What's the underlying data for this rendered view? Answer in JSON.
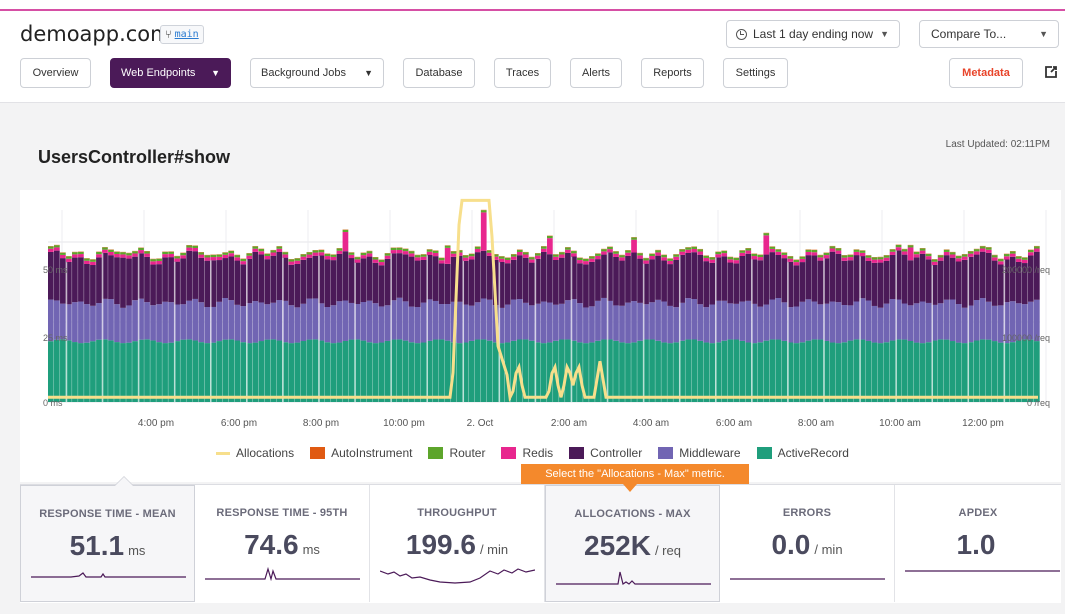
{
  "header": {
    "app_title": "demoapp.com",
    "branch": "main",
    "time_range": "Last 1 day ending now",
    "compare": "Compare To..."
  },
  "nav": {
    "overview": "Overview",
    "web_endpoints": "Web Endpoints",
    "background_jobs": "Background Jobs",
    "database": "Database",
    "traces": "Traces",
    "alerts": "Alerts",
    "reports": "Reports",
    "settings": "Settings",
    "metadata": "Metadata"
  },
  "page": {
    "title": "UsersController#show",
    "last_updated": "Last Updated: 02:11PM"
  },
  "chart_data": {
    "type": "area",
    "stacked": true,
    "x": [
      "4:00 pm",
      "6:00 pm",
      "8:00 pm",
      "10:00 pm",
      "2. Oct",
      "2:00 am",
      "4:00 am",
      "6:00 am",
      "8:00 am",
      "10:00 am",
      "12:00 pm"
    ],
    "y_left_ticks": [
      "0 ms",
      "25 ms",
      "50 ms"
    ],
    "y_right_ticks": [
      "0 /req",
      "100000 /req",
      "200000 /req"
    ],
    "ylim_left": [
      0,
      60
    ],
    "series": [
      {
        "name": "ActiveRecord",
        "color": "#1f9e7c",
        "typical": 19
      },
      {
        "name": "Middleware",
        "color": "#7165b3",
        "typical": 12
      },
      {
        "name": "Controller",
        "color": "#4b1a58",
        "typical": 14
      },
      {
        "name": "Redis",
        "color": "#e8268e",
        "typical": 1
      },
      {
        "name": "Router",
        "color": "#5da52b",
        "typical": 0.7
      },
      {
        "name": "AutoInstrument",
        "color": "#e05a12",
        "typical": 0.1
      }
    ],
    "line_series": {
      "name": "Allocations",
      "color": "#f7df8c",
      "axis": "right",
      "peak": 252000
    },
    "grid": true
  },
  "legend": [
    "Allocations",
    "AutoInstrument",
    "Router",
    "Redis",
    "Controller",
    "Middleware",
    "ActiveRecord"
  ],
  "colors": {
    "allocations": "#f7df8c",
    "autoinstrument": "#e05a12",
    "router": "#5da52b",
    "redis": "#e8268e",
    "controller": "#4b1a58",
    "middleware": "#7165b3",
    "activerecord": "#1f9e7c",
    "tooltip": "#f4892c"
  },
  "tooltip": "Select the \"Allocations - Max\" metric.",
  "metrics": [
    {
      "label": "RESPONSE TIME - MEAN",
      "value": "51.1",
      "unit": "ms"
    },
    {
      "label": "RESPONSE TIME - 95TH",
      "value": "74.6",
      "unit": "ms"
    },
    {
      "label": "THROUGHPUT",
      "value": "199.6",
      "unit": "/ min"
    },
    {
      "label": "ALLOCATIONS - MAX",
      "value": "252K",
      "unit": "/ req"
    },
    {
      "label": "ERRORS",
      "value": "0.0",
      "unit": "/ min"
    },
    {
      "label": "APDEX",
      "value": "1.0",
      "unit": ""
    }
  ]
}
